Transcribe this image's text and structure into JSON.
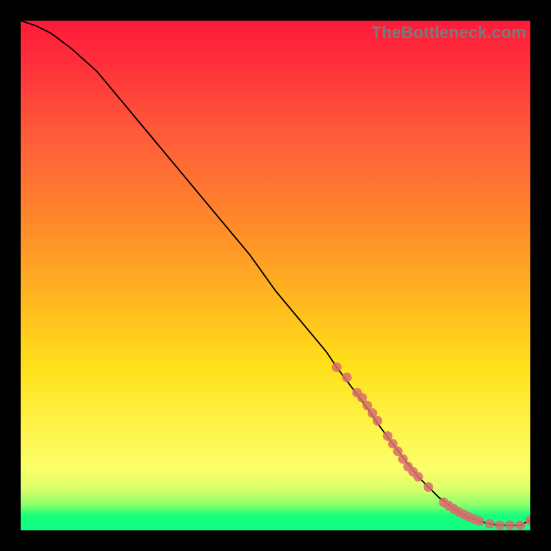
{
  "watermark": "TheBottleneck.com",
  "chart_data": {
    "type": "line",
    "title": "",
    "xlabel": "",
    "ylabel": "",
    "xlim": [
      0,
      100
    ],
    "ylim": [
      0,
      100
    ],
    "curve": {
      "name": "bottleneck-curve",
      "x": [
        0,
        3,
        6,
        10,
        15,
        20,
        25,
        30,
        35,
        40,
        45,
        50,
        55,
        60,
        62,
        65,
        68,
        70,
        73,
        76,
        78,
        80,
        82,
        84,
        86,
        88,
        90,
        92,
        94,
        96,
        98,
        100
      ],
      "y": [
        100,
        99,
        97.5,
        94.5,
        90,
        84,
        78,
        72,
        66,
        60,
        54,
        47,
        41,
        35,
        32,
        28,
        24,
        21,
        17,
        13,
        10.5,
        8.5,
        6.5,
        5,
        3.5,
        2.5,
        1.8,
        1.3,
        1,
        1,
        1,
        2
      ]
    },
    "highlight_points": {
      "name": "highlighted-range",
      "color": "#d96c6c",
      "x": [
        62,
        64,
        66,
        67,
        68,
        69,
        70,
        72,
        73,
        74,
        75,
        76,
        77,
        78,
        80,
        83,
        84,
        85,
        86,
        87,
        88,
        89,
        90,
        92,
        94,
        96,
        98,
        100
      ],
      "y": [
        32,
        30,
        27,
        26,
        24.5,
        23,
        21.5,
        18.5,
        17,
        15.5,
        14,
        12.5,
        11.5,
        10.5,
        8.5,
        5.5,
        4.8,
        4.2,
        3.6,
        3.1,
        2.6,
        2.2,
        1.8,
        1.3,
        1.0,
        1.0,
        1.0,
        2.0
      ]
    },
    "gradient_stops": [
      {
        "pos": 0.0,
        "color": "#ff1a3a"
      },
      {
        "pos": 0.22,
        "color": "#ff5a3a"
      },
      {
        "pos": 0.55,
        "color": "#ffb81f"
      },
      {
        "pos": 0.8,
        "color": "#fff44a"
      },
      {
        "pos": 0.95,
        "color": "#8aff6a"
      },
      {
        "pos": 1.0,
        "color": "#0eff84"
      }
    ]
  }
}
